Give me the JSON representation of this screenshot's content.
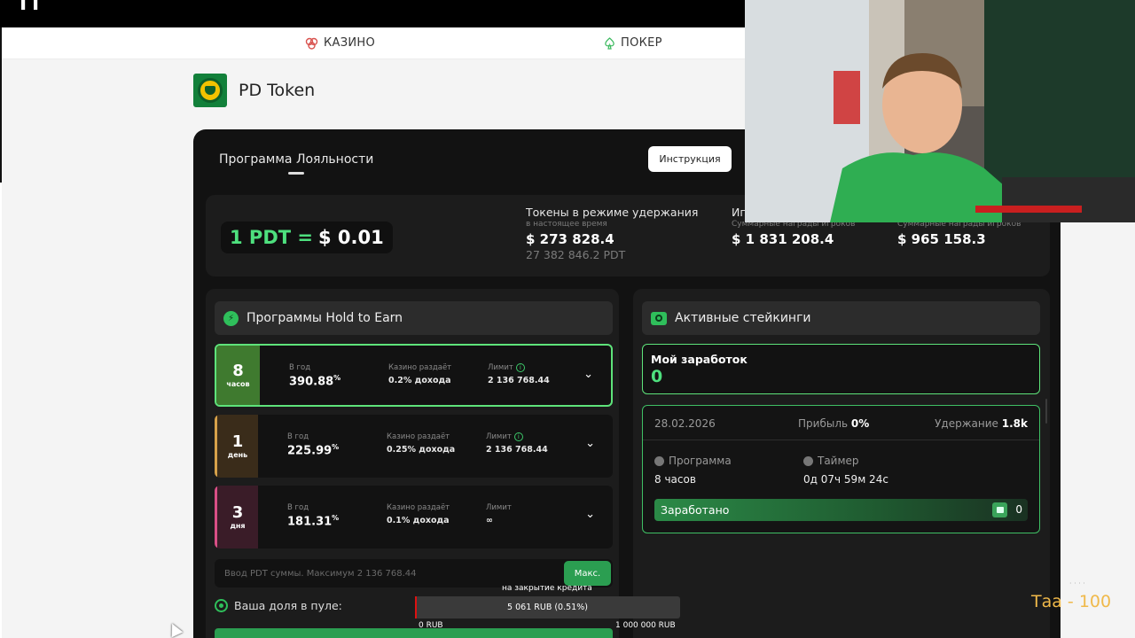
{
  "topbar": {
    "glyph": "ГГ"
  },
  "nav": {
    "casino_label": "КАЗИНО",
    "poker_label": "ПОКЕР"
  },
  "brand": {
    "name": "PD Token"
  },
  "panel": {
    "title": "Программа Лояльности",
    "instruction_button": "Инструкция"
  },
  "stats": {
    "rate_left": "1 PDT =",
    "rate_right": "$ 0.01",
    "held": {
      "title": "Токены в режиме удержания",
      "subtitle": "в настоящее время",
      "value_usd": "$ 273 828.4",
      "value_pdt": "27 382 846.2 PDT"
    },
    "games": {
      "title": "Иг",
      "subtitle": "Суммарные награды игроков",
      "value_usd": "$ 1 831 208.4"
    },
    "rewards": {
      "subtitle": "Суммарные награды игроков",
      "value_usd": "$ 965 158.3"
    }
  },
  "hold": {
    "header": "Программы Hold to Earn",
    "col_year": "В год",
    "col_casino": "Казино раздаёт",
    "col_limit": "Лимит",
    "plans": [
      {
        "num": "8",
        "unit": "часов",
        "rate": "390.88",
        "pct": "%",
        "casino": "0.2% дохода",
        "limit": "2 136 768.44",
        "color": "#3f7a2f"
      },
      {
        "num": "1",
        "unit": "день",
        "rate": "225.99",
        "pct": "%",
        "casino": "0.25% дохода",
        "limit": "2 136 768.44",
        "color": "#7a5a1e"
      },
      {
        "num": "3",
        "unit": "дня",
        "rate": "181.31",
        "pct": "%",
        "casino": "0.1% дохода",
        "limit": "∞",
        "color": "#7a2a4a"
      }
    ],
    "input_placeholder": "Ввод PDT суммы. Максимум 2 136 768.44",
    "max_button": "Макс.",
    "share_label": "Ваша доля в пуле:"
  },
  "staking": {
    "header": "Активные стейкинги",
    "my_earnings_label": "Мой заработок",
    "my_earnings_value": "0",
    "card": {
      "date": "28.02.2026",
      "profit_label": "Прибыль",
      "profit_value": "0%",
      "hold_label": "Удержание",
      "hold_value": "1.8k",
      "program_label": "Программа",
      "program_value": "8 часов",
      "timer_label": "Таймер",
      "timer_value": "0д 07ч 59м 24с",
      "earned_label": "Заработано",
      "earned_value": "0"
    }
  },
  "overlay": {
    "top_label": "на закрытие кредита",
    "bar_value": "5 061 RUB (0.51%)",
    "min_label": "0 RUB",
    "max_label": "1 000 000 RUB",
    "progress_fraction": 0.0051
  },
  "stream": {
    "goal_text": "Таа - 100",
    "dots": "· · · ·"
  },
  "colors": {
    "accent_green": "#4ee07e",
    "panel_bg": "#121212",
    "card_bg": "#1c1c1c",
    "overlay_text": "#f0b94a"
  }
}
